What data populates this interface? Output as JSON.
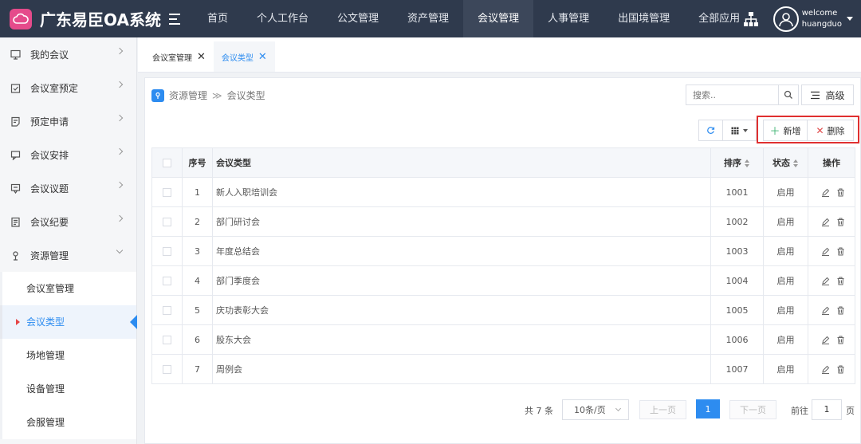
{
  "app": {
    "title": "广东易臣OA系统",
    "accent": "#2d8cf0",
    "topbar_bg": "#2f3a4d"
  },
  "topnav": {
    "items": [
      "首页",
      "个人工作台",
      "公文管理",
      "资产管理",
      "会议管理",
      "人事管理",
      "出国境管理",
      "全部应用"
    ],
    "active": "会议管理"
  },
  "user": {
    "greeting": "welcome",
    "name": "huangduo"
  },
  "sidebar": {
    "items": [
      {
        "label": "我的会议",
        "icon": "monitor-icon"
      },
      {
        "label": "会议室预定",
        "icon": "calendar-check-icon"
      },
      {
        "label": "预定申请",
        "icon": "form-icon"
      },
      {
        "label": "会议安排",
        "icon": "chat-icon"
      },
      {
        "label": "会议议题",
        "icon": "topic-icon"
      },
      {
        "label": "会议纪要",
        "icon": "notes-icon"
      },
      {
        "label": "资源管理",
        "icon": "location-icon"
      }
    ],
    "subitems": [
      "会议室管理",
      "会议类型",
      "场地管理",
      "设备管理",
      "会服管理"
    ],
    "active_sub": "会议类型"
  },
  "tabs": [
    {
      "label": "会议室管理"
    },
    {
      "label": "会议类型"
    }
  ],
  "breadcrumb": {
    "root": "资源管理",
    "current": "会议类型"
  },
  "search": {
    "placeholder": "搜索..",
    "advanced_label": "高级"
  },
  "toolbar": {
    "add_label": "新增",
    "delete_label": "删除",
    "add_color": "#3cb371",
    "delete_color": "#e04848",
    "highlight_color": "#e03030"
  },
  "table": {
    "headers": {
      "index": "序号",
      "type": "会议类型",
      "order": "排序",
      "status": "状态",
      "ops": "操作"
    },
    "rows": [
      {
        "index": "1",
        "type": "新人入职培训会",
        "order": "1001",
        "status": "启用"
      },
      {
        "index": "2",
        "type": "部门研讨会",
        "order": "1002",
        "status": "启用"
      },
      {
        "index": "3",
        "type": "年度总结会",
        "order": "1003",
        "status": "启用"
      },
      {
        "index": "4",
        "type": "部门季度会",
        "order": "1004",
        "status": "启用"
      },
      {
        "index": "5",
        "type": "庆功表彰大会",
        "order": "1005",
        "status": "启用"
      },
      {
        "index": "6",
        "type": "股东大会",
        "order": "1006",
        "status": "启用"
      },
      {
        "index": "7",
        "type": "周例会",
        "order": "1007",
        "status": "启用"
      }
    ]
  },
  "pagination": {
    "total": "共 7 条",
    "page_size": "10条/页",
    "prev": "上一页",
    "current": "1",
    "next": "下一页",
    "goto_label": "前往",
    "goto_value": "1",
    "page_unit": "页"
  }
}
